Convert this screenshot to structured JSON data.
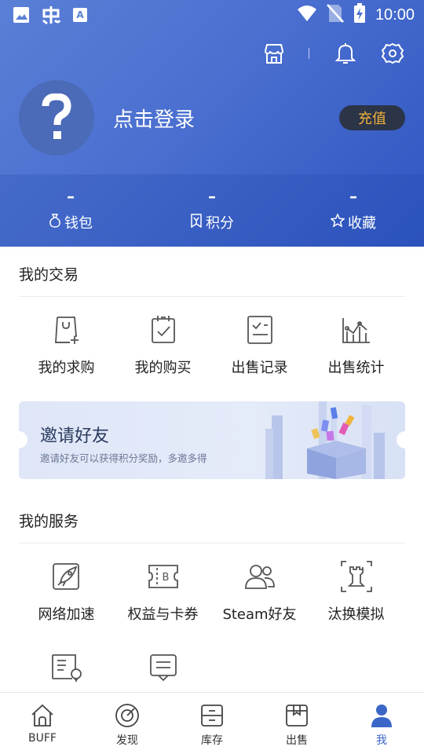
{
  "status_bar": {
    "time": "10:00",
    "icons": [
      "gallery-icon",
      "app-logo-icon",
      "a-icon",
      "wifi-icon",
      "no-sim-icon",
      "battery-charging-icon"
    ]
  },
  "header": {
    "icons": [
      "store-icon",
      "bell-icon",
      "settings-icon"
    ],
    "login_text": "点击登录",
    "recharge_label": "充值",
    "stats": [
      {
        "value": "–",
        "label": "钱包",
        "icon": "wallet-icon"
      },
      {
        "value": "–",
        "label": "积分",
        "icon": "points-icon"
      },
      {
        "value": "–",
        "label": "收藏",
        "icon": "star-icon"
      }
    ]
  },
  "trade": {
    "title": "我的交易",
    "items": [
      {
        "label": "我的求购",
        "icon": "bag-plus-icon"
      },
      {
        "label": "我的购买",
        "icon": "clipboard-check-icon"
      },
      {
        "label": "出售记录",
        "icon": "record-icon"
      },
      {
        "label": "出售统计",
        "icon": "chart-icon"
      }
    ]
  },
  "banner": {
    "title": "邀请好友",
    "subtitle": "邀请好友可以获得积分奖励，多邀多得"
  },
  "services": {
    "title": "我的服务",
    "items": [
      {
        "label": "网络加速",
        "icon": "rocket-icon"
      },
      {
        "label": "权益与卡券",
        "icon": "coupon-icon"
      },
      {
        "label": "Steam好友",
        "icon": "friends-icon"
      },
      {
        "label": "汰换模拟",
        "icon": "tradeup-icon"
      },
      {
        "label": "",
        "icon": "guide-icon"
      },
      {
        "label": "",
        "icon": "feedback-icon"
      }
    ]
  },
  "nav": {
    "items": [
      {
        "label": "BUFF",
        "icon": "home-icon"
      },
      {
        "label": "发现",
        "icon": "discover-icon"
      },
      {
        "label": "库存",
        "icon": "inventory-icon"
      },
      {
        "label": "出售",
        "icon": "sell-icon"
      },
      {
        "label": "我",
        "icon": "me-icon"
      }
    ],
    "active_index": 4
  },
  "colors": {
    "accent": "#3a66c8",
    "recharge_text": "#f0b33a",
    "header_start": "#5a7fd6",
    "header_end": "#2f56c2"
  }
}
